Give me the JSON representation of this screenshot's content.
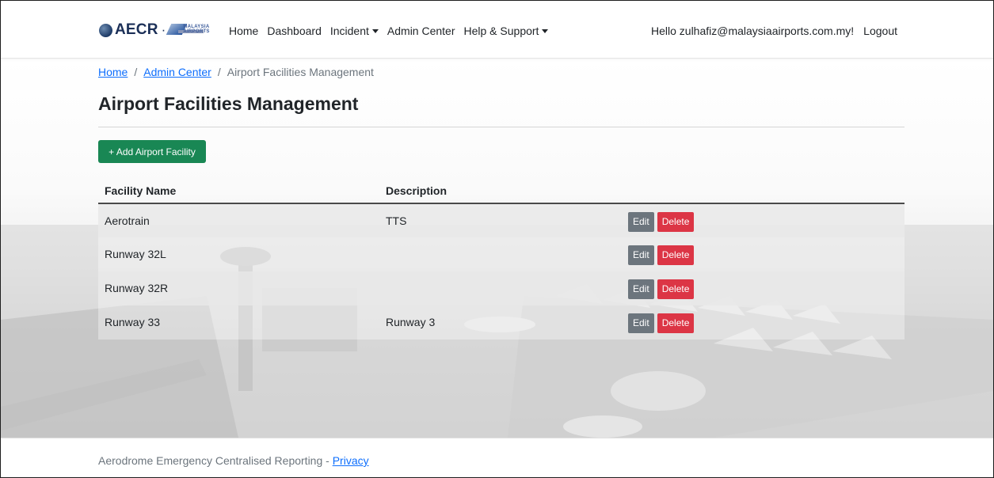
{
  "navbar": {
    "brand": "AECR",
    "brand_separator": "·",
    "partner_logo_text": "MALAYSIA AIRPORTS",
    "links": [
      {
        "label": "Home"
      },
      {
        "label": "Dashboard"
      },
      {
        "label": "Incident"
      },
      {
        "label": "Admin Center"
      },
      {
        "label": "Help & Support"
      }
    ],
    "greeting": "Hello zulhafiz@malaysiaairports.com.my!",
    "logout": "Logout"
  },
  "breadcrumb": {
    "home": "Home",
    "admin": "Admin Center",
    "current": "Airport Facilities Management",
    "separator": "/"
  },
  "page": {
    "title": "Airport Facilities Management",
    "add_button": "+ Add Airport Facility"
  },
  "table": {
    "headers": [
      "Facility Name",
      "Description",
      ""
    ],
    "rows": [
      {
        "name": "Aerotrain",
        "description": "TTS",
        "edit": "Edit",
        "delete": "Delete"
      },
      {
        "name": "Runway 32L",
        "description": "",
        "edit": "Edit",
        "delete": "Delete"
      },
      {
        "name": "Runway 32R",
        "description": "",
        "edit": "Edit",
        "delete": "Delete"
      },
      {
        "name": "Runway 33",
        "description": "Runway 3",
        "edit": "Edit",
        "delete": "Delete"
      }
    ]
  },
  "footer": {
    "text": "Aerodrome Emergency Centralised Reporting - ",
    "privacy": "Privacy"
  },
  "colors": {
    "primary_link": "#0d6efd",
    "success": "#198754",
    "secondary": "#6c757d",
    "danger": "#dc3545",
    "brand_navy": "#1b2f57"
  },
  "icons": [
    "globe-logo-icon",
    "caret-down-icon"
  ]
}
